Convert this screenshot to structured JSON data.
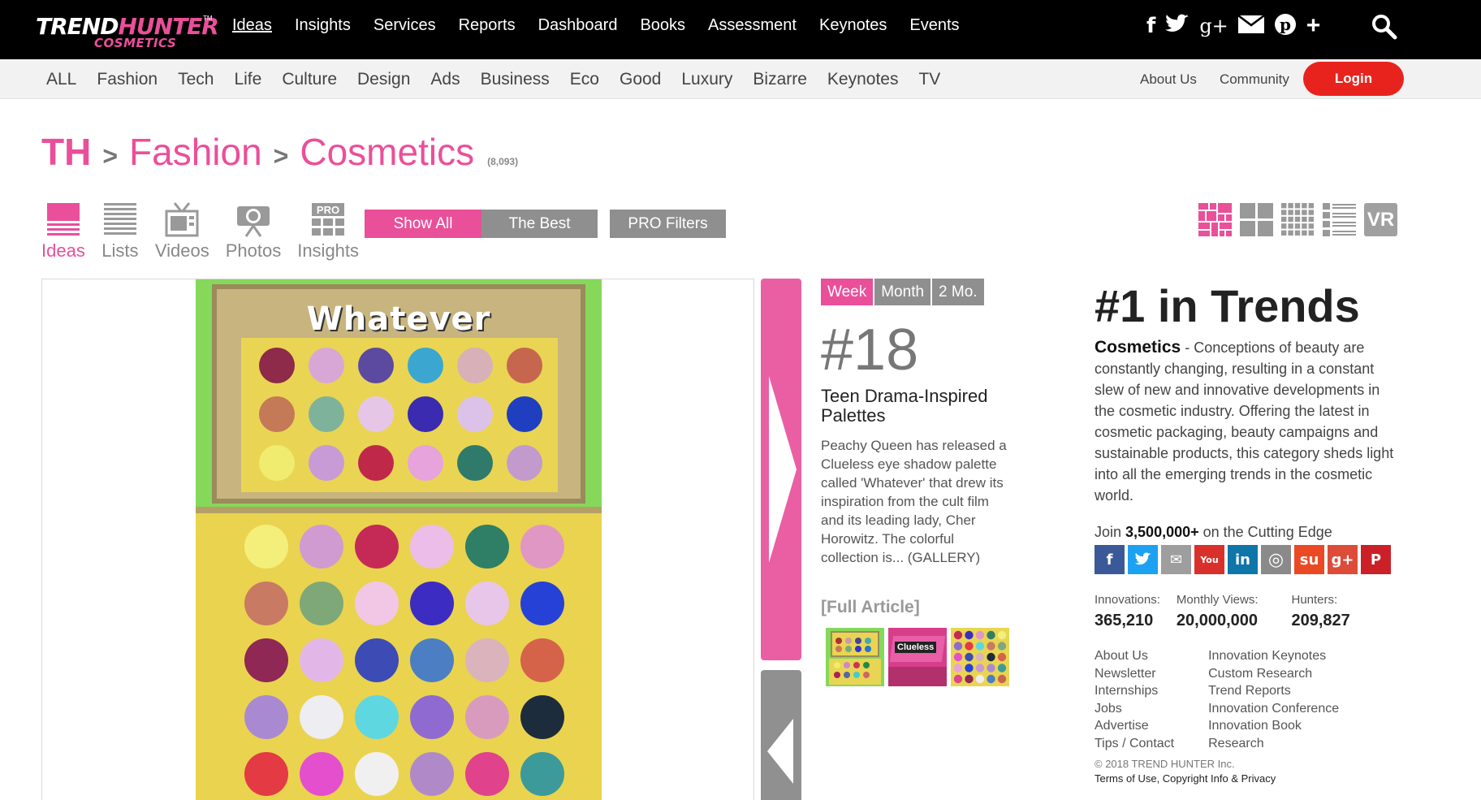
{
  "brand": {
    "logo_white": "TREND",
    "logo_pink": "HUNTER",
    "logo_sub": "COSMETICS",
    "tm": "TM",
    "accent": "#ea4f9a",
    "login_color": "#e8231d"
  },
  "main_nav": {
    "items": [
      "Ideas",
      "Insights",
      "Services",
      "Reports",
      "Dashboard",
      "Books",
      "Assessment",
      "Keynotes",
      "Events"
    ],
    "active": "Ideas"
  },
  "social_top": [
    "facebook-icon",
    "twitter-icon",
    "google-plus-icon",
    "mail-icon",
    "pinterest-icon",
    "plus-icon"
  ],
  "category_nav": {
    "items": [
      "ALL",
      "Fashion",
      "Tech",
      "Life",
      "Culture",
      "Design",
      "Ads",
      "Business",
      "Eco",
      "Good",
      "Luxury",
      "Bizarre",
      "Keynotes",
      "TV"
    ],
    "right_links": [
      "About Us",
      "Community"
    ],
    "login": "Login"
  },
  "breadcrumb": {
    "root": "TH",
    "sep": ">",
    "category": "Fashion",
    "subcategory": "Cosmetics",
    "count": "(8,093)"
  },
  "view_tabs": [
    {
      "label": "Ideas",
      "icon": "ideas-icon",
      "active": true
    },
    {
      "label": "Lists",
      "icon": "lists-icon",
      "active": false
    },
    {
      "label": "Videos",
      "icon": "tv-icon",
      "active": false
    },
    {
      "label": "Photos",
      "icon": "camera-icon",
      "active": false
    },
    {
      "label": "Insights",
      "icon": "pro-grid-icon",
      "active": false
    }
  ],
  "filters": {
    "show_all": "Show All",
    "the_best": "The Best",
    "pro_filters": "PRO Filters"
  },
  "layout_options": [
    "mosaic-layout-icon",
    "large-grid-layout-icon",
    "small-grid-layout-icon",
    "list-layout-icon"
  ],
  "layout_vr": "VR",
  "hero": {
    "palette_text": "Whatever"
  },
  "trend": {
    "time_tabs": [
      "Week",
      "Month",
      "2 Mo."
    ],
    "active_tab": "Week",
    "rank": "#18",
    "title": "Teen Drama-Inspired Palettes",
    "description": "Peachy Queen has released a Clueless eye shadow palette called 'Whatever' that drew its inspiration from the cult film and its leading lady, Cher Horowitz. The colorful collection is... (GALLERY)",
    "full_article": "[Full Article]",
    "thumb2_text": "Clueless"
  },
  "sidebar": {
    "title": "#1 in Trends",
    "desc_bold": "Cosmetics",
    "desc": " - Conceptions of beauty are constantly changing, resulting in a constant slew of new and innovative developments in the cosmetic industry. Offering the latest in cosmetic packaging, beauty campaigns and sustainable products, this category sheds light into all the emerging trends in the cosmetic world.",
    "join_pre": "Join ",
    "join_bold": "3,500,000+",
    "join_post": " on the Cutting Edge",
    "social": [
      {
        "icon": "facebook-icon",
        "glyph": "f",
        "color": "#3b5998"
      },
      {
        "icon": "twitter-icon",
        "glyph": "t",
        "color": "#1da1f2"
      },
      {
        "icon": "mail-icon",
        "glyph": "✉",
        "color": "#9e9e9e"
      },
      {
        "icon": "youtube-icon",
        "glyph": "You",
        "color": "#d9302c"
      },
      {
        "icon": "linkedin-icon",
        "glyph": "in",
        "color": "#0e76a8"
      },
      {
        "icon": "instagram-icon",
        "glyph": "◎",
        "color": "#8a8a8a"
      },
      {
        "icon": "stumbleupon-icon",
        "glyph": "su",
        "color": "#eb4924"
      },
      {
        "icon": "google-plus-icon",
        "glyph": "g+",
        "color": "#dd4b39"
      },
      {
        "icon": "pinterest-icon",
        "glyph": "P",
        "color": "#cb2027"
      }
    ],
    "stats": [
      {
        "label": "Innovations:",
        "value": "365,210"
      },
      {
        "label": "Monthly Views:",
        "value": "20,000,000"
      },
      {
        "label": "Hunters:",
        "value": "209,827"
      }
    ],
    "links_left": [
      "About Us",
      "Newsletter",
      "Internships",
      "Jobs",
      "Advertise",
      "Tips / Contact"
    ],
    "links_right": [
      "Innovation Keynotes",
      "Custom Research",
      "Trend Reports",
      "Innovation Conference",
      "Innovation Book",
      "Research"
    ],
    "copyright": "© 2018 TREND HUNTER Inc.",
    "terms": "Terms of Use, Copyright Info & Privacy"
  }
}
